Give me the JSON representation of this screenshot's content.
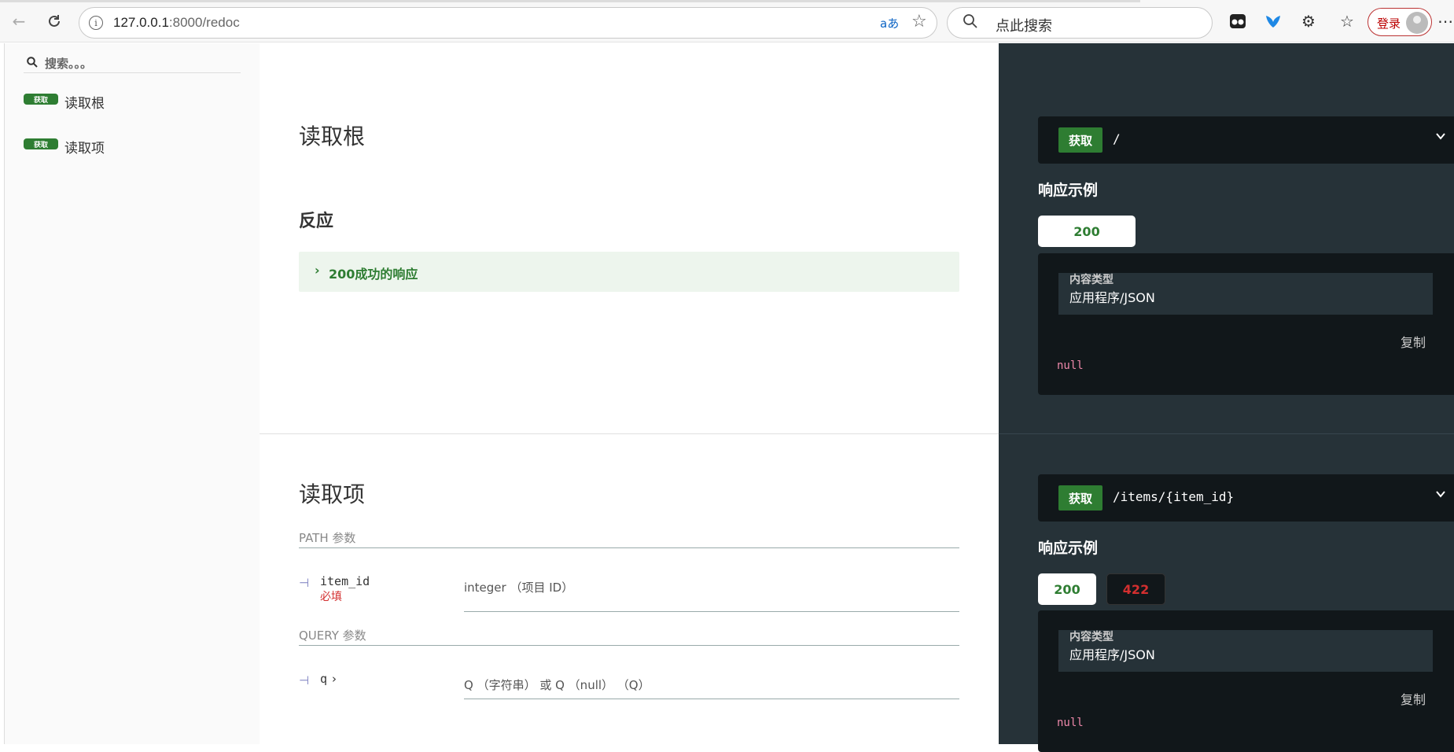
{
  "browser": {
    "url_host": "127.0.0.1",
    "url_rest": ":8000/redoc",
    "translate_label": "aあ",
    "search_placeholder": "点此搜索",
    "login_label": "登录"
  },
  "sidebar": {
    "search_placeholder": "搜索。。。",
    "items": [
      {
        "badge": "获取",
        "label": "读取根"
      },
      {
        "badge": "获取",
        "label": "读取项"
      }
    ]
  },
  "operations": [
    {
      "title": "读取根",
      "responses_heading": "反应",
      "response_200": "200成功的响应",
      "method": "获取",
      "path": "/",
      "samples_heading": "响应示例",
      "codes": [
        "200"
      ],
      "content_type_label": "内容类型",
      "content_type": "应用程序/JSON",
      "copy_label": "复制",
      "sample_body": "null"
    },
    {
      "title": "读取项",
      "path_params_heading": "PATH 参数",
      "path_param": {
        "name": "item_id",
        "required": "必填",
        "type": "integer （项目 ID）"
      },
      "query_params_heading": "QUERY 参数",
      "query_param": {
        "name": "q",
        "type": "Q （字符串） 或 Q （null） （Q）"
      },
      "method": "获取",
      "path": "/items/{item_id}",
      "samples_heading": "响应示例",
      "codes": [
        "200",
        "422"
      ],
      "content_type_label": "内容类型",
      "content_type": "应用程序/JSON",
      "copy_label": "复制",
      "sample_body": "null"
    }
  ],
  "colors": {
    "get": "#2e7d32",
    "error": "#d32f2f",
    "right_panel": "#263238"
  }
}
